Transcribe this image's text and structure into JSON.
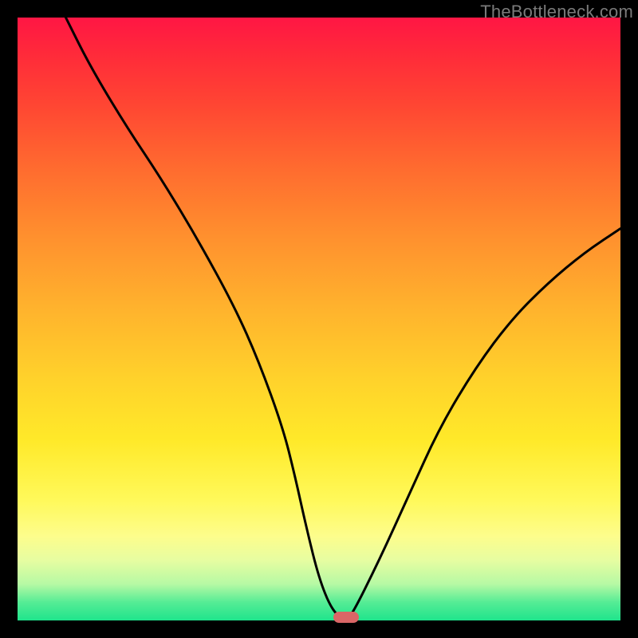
{
  "watermark": {
    "text": "TheBottleneck.com"
  },
  "chart_data": {
    "type": "line",
    "title": "",
    "xlabel": "",
    "ylabel": "",
    "xlim": [
      0,
      100
    ],
    "ylim": [
      0,
      100
    ],
    "grid": false,
    "legend": false,
    "background_gradient": {
      "stops": [
        {
          "pos": 0,
          "color": "#ff1644"
        },
        {
          "pos": 14,
          "color": "#ff4433"
        },
        {
          "pos": 36,
          "color": "#ff8f2e"
        },
        {
          "pos": 60,
          "color": "#ffd22b"
        },
        {
          "pos": 80,
          "color": "#fff95a"
        },
        {
          "pos": 94,
          "color": "#b6f9a4"
        },
        {
          "pos": 100,
          "color": "#1fe48c"
        }
      ]
    },
    "series": [
      {
        "name": "bottleneck-curve",
        "color": "#000000",
        "x": [
          8,
          12,
          18,
          24,
          30,
          36,
          40,
          44,
          46,
          48,
          50,
          52,
          54,
          55,
          60,
          65,
          70,
          76,
          82,
          88,
          94,
          100
        ],
        "y": [
          100,
          92,
          82,
          73,
          63,
          52,
          43,
          32,
          24,
          15,
          7,
          2,
          0,
          0,
          10,
          21,
          32,
          42,
          50,
          56,
          61,
          65
        ]
      }
    ],
    "marker": {
      "x": 54.5,
      "y": 0.5,
      "color": "#da6666"
    }
  }
}
